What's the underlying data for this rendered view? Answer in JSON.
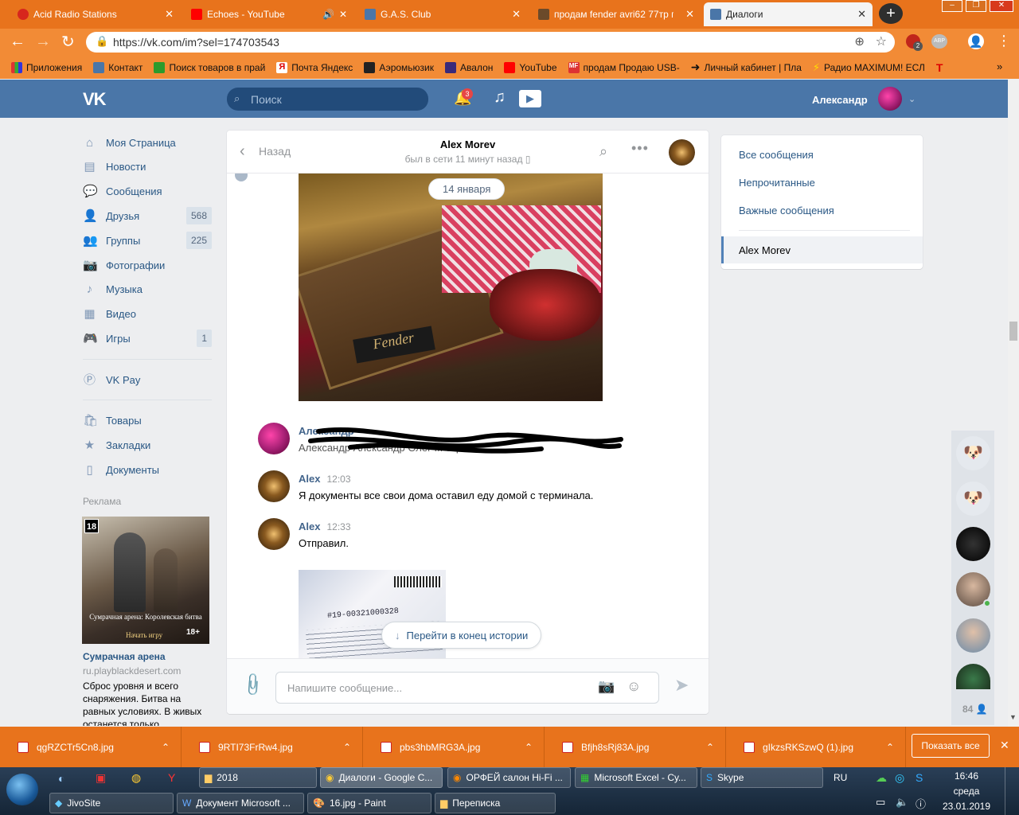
{
  "browser": {
    "tabs": [
      {
        "title": "Acid Radio Stations",
        "color": "#d7261d"
      },
      {
        "title": "Echoes - YouTube",
        "color": "#ff0000"
      },
      {
        "title": "G.A.S. Club",
        "color": "#4a76a8"
      },
      {
        "title": "продам fender avri62 77тр прод",
        "color": "#6b4a2a"
      },
      {
        "title": "Диалоги",
        "color": "#4a76a8"
      }
    ],
    "url": "https://vk.com/im?sel=174703543",
    "ext_badge": "2",
    "ext_label": "ABP",
    "bookmarks": [
      "Приложения",
      "Контакт",
      "Поиск товаров в прай",
      "Почта Яндекс",
      "Аэромьюзик",
      "Авалон",
      "YouTube",
      "продам Продаю USB-",
      "Личный кабинет | Пла",
      "Радио MAXIMUM! ЕСЛ"
    ]
  },
  "vk": {
    "search_placeholder": "Поиск",
    "notif_count": "3",
    "user_name": "Александр",
    "menu": [
      {
        "label": "Моя Страница",
        "icon": "home-icon",
        "count": ""
      },
      {
        "label": "Новости",
        "icon": "news-icon",
        "count": ""
      },
      {
        "label": "Сообщения",
        "icon": "messages-icon",
        "count": ""
      },
      {
        "label": "Друзья",
        "icon": "friends-icon",
        "count": "568"
      },
      {
        "label": "Группы",
        "icon": "groups-icon",
        "count": "225"
      },
      {
        "label": "Фотографии",
        "icon": "camera-icon",
        "count": ""
      },
      {
        "label": "Музыка",
        "icon": "music-icon",
        "count": ""
      },
      {
        "label": "Видео",
        "icon": "video-icon",
        "count": ""
      },
      {
        "label": "Игры",
        "icon": "games-icon",
        "count": "1"
      },
      {
        "label": "VK Pay",
        "icon": "vkpay-icon",
        "count": ""
      },
      {
        "label": "Товары",
        "icon": "goods-icon",
        "count": ""
      },
      {
        "label": "Закладки",
        "icon": "star-icon",
        "count": ""
      },
      {
        "label": "Документы",
        "icon": "document-icon",
        "count": ""
      }
    ],
    "ad": {
      "header": "Реклама",
      "age": "18",
      "image_caption": "Сумрачная арена: Королевская битва",
      "image_button": "Начать игру",
      "image_age": "18+",
      "title": "Сумрачная арена",
      "domain": "ru.playblackdesert.com",
      "text": "Сброс уровня и всего снаряжения. Битва на равных условиях. В живых останется только"
    },
    "chat": {
      "back": "Назад",
      "peer_name": "Alex Morev",
      "peer_status": "был в сети 11 минут назад",
      "date_badge": "14 января",
      "messages": [
        {
          "author": "Александр",
          "time": "",
          "text": "Александр Александр Олег ... тор ..."
        },
        {
          "author": "Alex",
          "time": "12:03",
          "text": "Я документы все свои дома оставил еду домой с терминала."
        },
        {
          "author": "Alex",
          "time": "12:33",
          "text": "Отправил."
        }
      ],
      "receipt_number": "#19-00321000328",
      "jump_button": "Перейти в конец истории",
      "input_placeholder": "Напишите сообщение..."
    },
    "right_panel": {
      "items": [
        "Все сообщения",
        "Непрочитанные",
        "Важные сообщения"
      ],
      "active": "Alex Morev"
    },
    "online_count": "84"
  },
  "downloads": {
    "files": [
      "qgRZCTr5Cn8.jpg",
      "9RTI73FrRw4.jpg",
      "pbs3hbMRG3A.jpg",
      "Bfjh8sRj83A.jpg",
      "gIkzsRKSzwQ (1).jpg"
    ],
    "show_all": "Показать все"
  },
  "taskbar": {
    "row1": [
      "2018",
      "Диалоги - Google C...",
      "ОРФЕЙ салон Hi-Fi ...",
      "Microsoft Excel - Су...",
      "Skype"
    ],
    "row2": [
      "JivoSite",
      "Документ Microsoft ...",
      "16.jpg - Paint",
      "Переписка"
    ],
    "lang": "RU",
    "time": "16:46",
    "day": "среда",
    "date": "23.01.2019"
  }
}
